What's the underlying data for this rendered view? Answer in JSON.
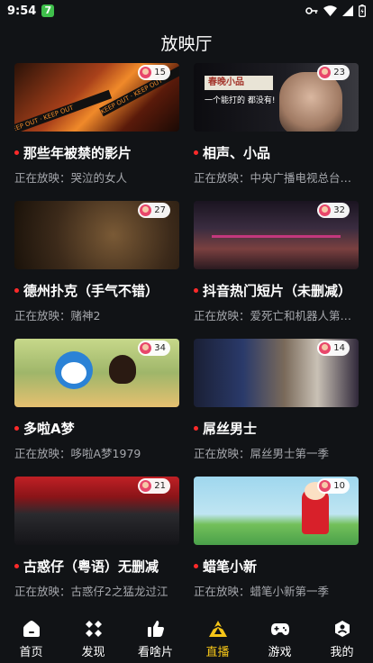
{
  "status_bar": {
    "time": "9:54",
    "app_badge": "7"
  },
  "header": {
    "title": "放映厅"
  },
  "cards": [
    {
      "title": "那些年被禁的影片",
      "subtitle": "正在放映：哭泣的女人",
      "viewers": "15",
      "thumb_text": "KEEP OUT"
    },
    {
      "title": "相声、小品",
      "subtitle": "正在放映：中央广播电视总台…",
      "viewers": "23",
      "thumb_text": "春晚小品",
      "thumb_text2": "一个能打的 都没有!"
    },
    {
      "title": "德州扑克（手气不错）",
      "subtitle": "正在放映：赌神2",
      "viewers": "27"
    },
    {
      "title": "抖音热门短片（未删减）",
      "subtitle": "正在放映：爱死亡和机器人第…",
      "viewers": "32"
    },
    {
      "title": "多啦A梦",
      "subtitle": "正在放映：哆啦A梦1979",
      "viewers": "34"
    },
    {
      "title": "屌丝男士",
      "subtitle": "正在放映：屌丝男士第一季",
      "viewers": "14"
    },
    {
      "title": "古惑仔（粤语）无删减",
      "subtitle": "正在放映：古惑仔2之猛龙过江",
      "viewers": "21"
    },
    {
      "title": "蜡笔小新",
      "subtitle": "正在放映：蜡笔小新第一季",
      "viewers": "10"
    }
  ],
  "bottom_nav": [
    {
      "label": "首页",
      "icon": "home-icon"
    },
    {
      "label": "发现",
      "icon": "discover-icon"
    },
    {
      "label": "看啥片",
      "icon": "thumbs-up-icon"
    },
    {
      "label": "直播",
      "icon": "live-icon",
      "active": true
    },
    {
      "label": "游戏",
      "icon": "gamepad-icon"
    },
    {
      "label": "我的",
      "icon": "profile-icon"
    }
  ],
  "colors": {
    "background": "#111316",
    "active_tab": "#f5c518",
    "live_dot": "#ff2a2a",
    "subtitle": "#a6a8ad"
  }
}
